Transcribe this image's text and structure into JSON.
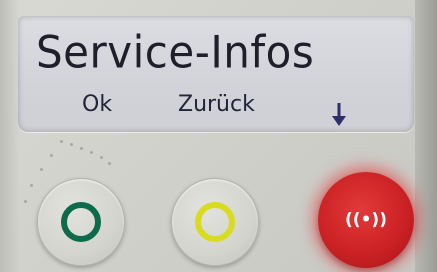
{
  "display": {
    "title": "Service-Infos",
    "softkeys": {
      "ok_label": "Ok",
      "back_label": "Zurück",
      "scroll_icon": "arrow-down-icon"
    }
  },
  "buttons": {
    "ok_color": "#0d6b4b",
    "back_color": "#d8dc20",
    "emergency_color": "#cc2225",
    "emergency_icon": "broadcast-signal-icon",
    "emergency_glyph": "((•))"
  }
}
